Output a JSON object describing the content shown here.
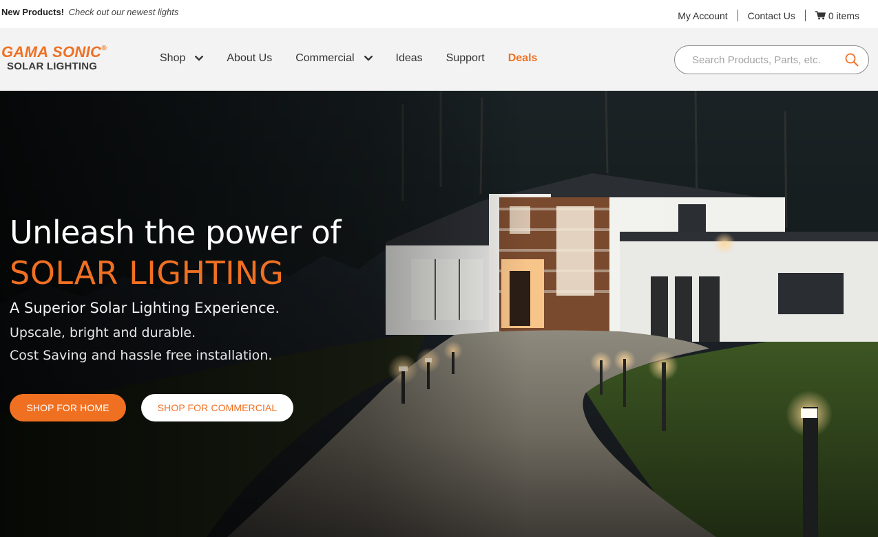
{
  "announcement": {
    "bold": "New Products!",
    "italic": "Check out our newest lights"
  },
  "utility_nav": {
    "my_account": "My Account",
    "contact_us": "Contact Us",
    "cart": "0 items",
    "cart_icon": "shopping-cart-icon"
  },
  "logo": {
    "top": "GAMA SONIC",
    "registered": "®",
    "bottom": "SOLAR LIGHTING"
  },
  "nav": {
    "items": [
      {
        "label": "Shop",
        "has_dropdown": true
      },
      {
        "label": "About Us",
        "has_dropdown": false
      },
      {
        "label": "Commercial",
        "has_dropdown": true
      },
      {
        "label": "Ideas",
        "has_dropdown": false
      },
      {
        "label": "Support",
        "has_dropdown": false
      },
      {
        "label": "Deals",
        "has_dropdown": false
      }
    ]
  },
  "search": {
    "placeholder": "Search Products, Parts, etc.",
    "value": "",
    "icon": "search-icon"
  },
  "hero": {
    "headline_1": "Unleash the power of",
    "headline_2": "SOLAR LIGHTING",
    "subhead": "A Superior Solar Lighting Experience.",
    "line_1": "Upscale, bright and durable.",
    "line_2": "Cost Saving and hassle free installation.",
    "cta_home": "SHOP FOR HOME",
    "cta_commercial": "SHOP FOR COMMERCIAL"
  },
  "colors": {
    "accent": "#f07022",
    "header_bg": "#f3f3f3",
    "text": "#333333"
  }
}
